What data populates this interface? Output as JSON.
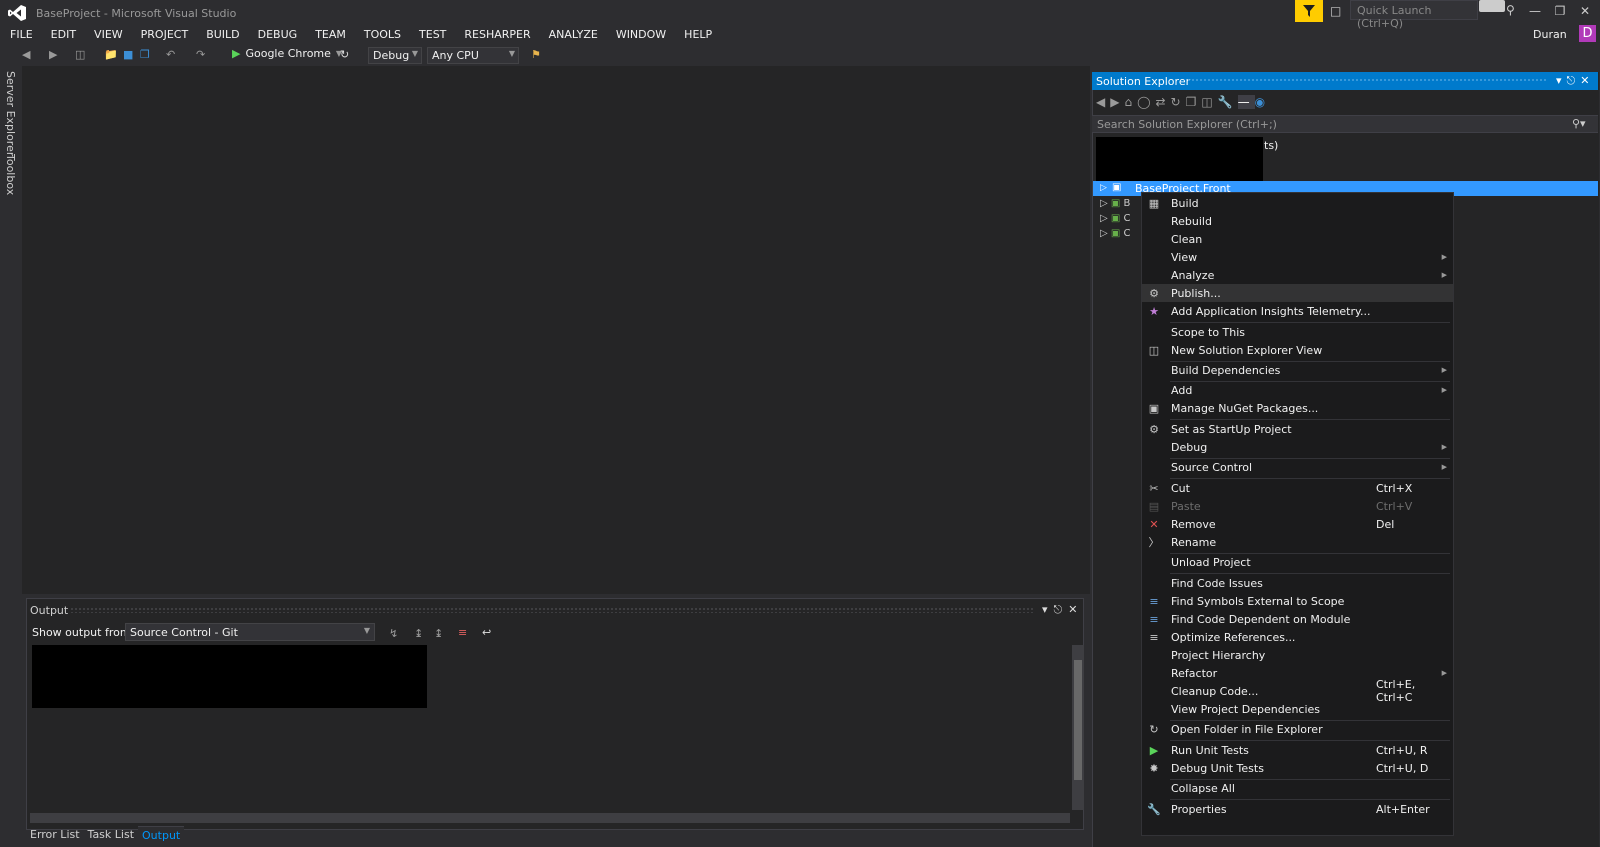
{
  "window": {
    "title": "BaseProject - Microsoft Visual Studio"
  },
  "quick_launch": {
    "placeholder": "Quick Launch (Ctrl+Q)"
  },
  "user": {
    "name": "Duran",
    "avatar_letter": "D",
    "avatar_color": "#b13ab9"
  },
  "menu": [
    "FILE",
    "EDIT",
    "VIEW",
    "PROJECT",
    "BUILD",
    "DEBUG",
    "TEAM",
    "TOOLS",
    "TEST",
    "RESHARPER",
    "ANALYZE",
    "WINDOW",
    "HELP"
  ],
  "toolbar": {
    "run_target": "Google Chrome",
    "configuration": "Debug",
    "platform": "Any CPU"
  },
  "side_tabs": [
    "Server Explorer",
    "Toolbox"
  ],
  "output": {
    "title": "Output",
    "show_label": "Show output from:",
    "source": "Source Control - Git"
  },
  "bottom_tabs": [
    "Error List",
    "Task List",
    "Output"
  ],
  "solution_explorer": {
    "title": "Solution Explorer",
    "search_placeholder": "Search Solution Explorer (Ctrl+;)",
    "solution_tail": "ts)",
    "selected_project": "BaseProject.Front",
    "project_rows": [
      "B",
      "C",
      "C"
    ],
    "accent": "#007acc"
  },
  "context_menu": {
    "items": [
      {
        "label": "Build",
        "icon": "build-icon"
      },
      {
        "label": "Rebuild"
      },
      {
        "label": "Clean"
      },
      {
        "label": "View",
        "submenu": true
      },
      {
        "label": "Analyze",
        "submenu": true
      },
      {
        "label": "Publish...",
        "icon": "publish-icon",
        "highlighted": true
      },
      {
        "label": "Add Application Insights Telemetry...",
        "icon": "insights-icon"
      },
      {
        "label": "Scope to This"
      },
      {
        "label": "New Solution Explorer View",
        "icon": "new-view-icon"
      },
      {
        "label": "Build Dependencies",
        "submenu": true
      },
      {
        "label": "Add",
        "submenu": true
      },
      {
        "label": "Manage NuGet Packages...",
        "icon": "nuget-icon"
      },
      {
        "label": "Set as StartUp Project",
        "icon": "gear-icon"
      },
      {
        "label": "Debug",
        "submenu": true
      },
      {
        "label": "Source Control",
        "submenu": true
      },
      {
        "label": "Cut",
        "icon": "scissors-icon",
        "shortcut": "Ctrl+X"
      },
      {
        "label": "Paste",
        "icon": "paste-icon",
        "shortcut": "Ctrl+V",
        "disabled": true
      },
      {
        "label": "Remove",
        "icon": "remove-icon",
        "shortcut": "Del"
      },
      {
        "label": "Rename",
        "icon": "rename-icon"
      },
      {
        "label": "Unload Project"
      },
      {
        "label": "Find Code Issues"
      },
      {
        "label": "Find Symbols External to Scope",
        "icon": "symbols-icon"
      },
      {
        "label": "Find Code Dependent on Module",
        "icon": "dependent-icon"
      },
      {
        "label": "Optimize References...",
        "icon": "optimize-icon"
      },
      {
        "label": "Project Hierarchy"
      },
      {
        "label": "Refactor",
        "submenu": true
      },
      {
        "label": "Cleanup Code...",
        "shortcut": "Ctrl+E, Ctrl+C"
      },
      {
        "label": "View Project Dependencies"
      },
      {
        "label": "Open Folder in File Explorer",
        "icon": "refresh-icon"
      },
      {
        "label": "Run Unit Tests",
        "icon": "run-icon",
        "shortcut": "Ctrl+U, R"
      },
      {
        "label": "Debug Unit Tests",
        "icon": "bug-icon",
        "shortcut": "Ctrl+U, D"
      },
      {
        "label": "Collapse All"
      },
      {
        "label": "Properties",
        "icon": "wrench-icon",
        "shortcut": "Alt+Enter"
      }
    ]
  }
}
